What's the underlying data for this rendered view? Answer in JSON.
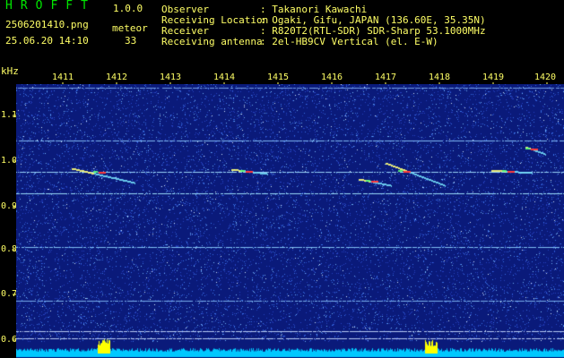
{
  "app": {
    "name": "HROFFT",
    "version": "1.0.0"
  },
  "file": {
    "name": "2506201410.png",
    "datetime": "25.06.20 14:10"
  },
  "detection": {
    "label": "meteor",
    "count": "33"
  },
  "station": {
    "fields": [
      {
        "key": "Observer",
        "value": ": Takanori Kawachi"
      },
      {
        "key": "Receiving Location",
        "value": ": Ogaki, Gifu, JAPAN (136.60E, 35.35N)"
      },
      {
        "key": "Receiver",
        "value": ": R820T2(RTL-SDR) SDR-Sharp 53.1000MHz"
      },
      {
        "key": "Receiving antenna",
        "value": ": 2el-HB9CV Vertical (el. E-W)"
      }
    ]
  },
  "axes": {
    "y_unit": "kHz",
    "x_ticks": [
      "1411",
      "1412",
      "1413",
      "1414",
      "1415",
      "1416",
      "1417",
      "1418",
      "1419",
      "1420"
    ],
    "y_ticks": [
      "1.1",
      "1.0",
      "0.9",
      "0.8",
      "0.7",
      "0.6"
    ]
  },
  "colors": {
    "background": "#000000",
    "spectrum_base": "#0a1a7a",
    "text": "#ffff66",
    "title": "#00e600",
    "signal_line": "#8fd8ff",
    "meteor_echo": "#ff3b3b",
    "spectrum_bar": "#ffff00"
  }
}
